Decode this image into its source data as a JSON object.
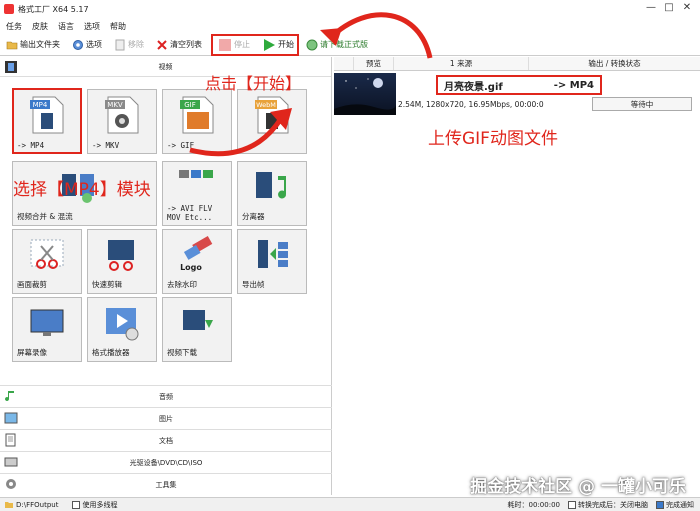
{
  "window": {
    "title": "格式工厂 X64 5.17"
  },
  "window_controls": [
    "—",
    "□",
    "✕"
  ],
  "menu": [
    "任务",
    "皮肤",
    "语言",
    "选项",
    "帮助"
  ],
  "toolbar": {
    "output_folder": "输出文件夹",
    "options": "选项",
    "remove": "移除",
    "clear_list": "清空列表",
    "stop": "停止",
    "start": "开始",
    "download_full": "请下载正式版"
  },
  "video_category": "视频",
  "tiles": [
    {
      "icon": "mp4-file-icon",
      "badge": "MP4",
      "label": "-> MP4"
    },
    {
      "icon": "mkv-file-icon",
      "badge": "MKV",
      "label": "-> MKV"
    },
    {
      "icon": "gif-file-icon",
      "badge": "GIF",
      "label": "-> GIF"
    },
    {
      "icon": "webm-file-icon",
      "badge": "WebM",
      "label": ""
    },
    {
      "icon": "video-merge-icon",
      "badge": "",
      "label": "视频合并 & 混流"
    },
    {
      "icon": "avi-flv-icon",
      "badge": "",
      "label": "-> AVI FLV\nMOV Etc..."
    },
    {
      "icon": "splitter-icon",
      "badge": "",
      "label": "分离器"
    },
    {
      "icon": "crop-icon",
      "badge": "",
      "label": "画面裁剪"
    },
    {
      "icon": "quick-cut-icon",
      "badge": "",
      "label": "快速剪辑"
    },
    {
      "icon": "watermark-remove-icon",
      "badge": "Logo",
      "label": "去除水印"
    },
    {
      "icon": "export-frames-icon",
      "badge": "",
      "label": "导出帧"
    },
    {
      "icon": "screen-record-icon",
      "badge": "",
      "label": "屏幕录像"
    },
    {
      "icon": "player-icon",
      "badge": "",
      "label": "格式播放器"
    },
    {
      "icon": "video-download-icon",
      "badge": "",
      "label": "视频下载"
    }
  ],
  "lower_categories": [
    "音频",
    "图片",
    "文档",
    "光驱设备\\DVD\\CD\\ISO",
    "工具集"
  ],
  "table": {
    "headers": [
      "预览",
      "1 来源",
      "输出 / 转换状态"
    ],
    "row": {
      "filename": "月亮夜景.gif",
      "target": "-> MP4",
      "info": "2.54M, 1280x720, 16.95Mbps, 00:00:0",
      "status": "等待中"
    }
  },
  "statusbar": {
    "output_path": "D:\\FFOutput",
    "multithread": "使用多线程",
    "elapsed": "耗时：00:00:00",
    "after_convert": "转换完成后：关闭电脑",
    "notify": "完成通知"
  },
  "annotations": {
    "click_start": "点击【开始】",
    "upload_gif": "上传GIF动图文件",
    "select_mp4": "选择【MP4】模块"
  },
  "watermark": "掘金技术社区 @ 一罐小可乐",
  "colors": {
    "accent_red": "#e0261c",
    "start_green": "#2eaa3c"
  }
}
